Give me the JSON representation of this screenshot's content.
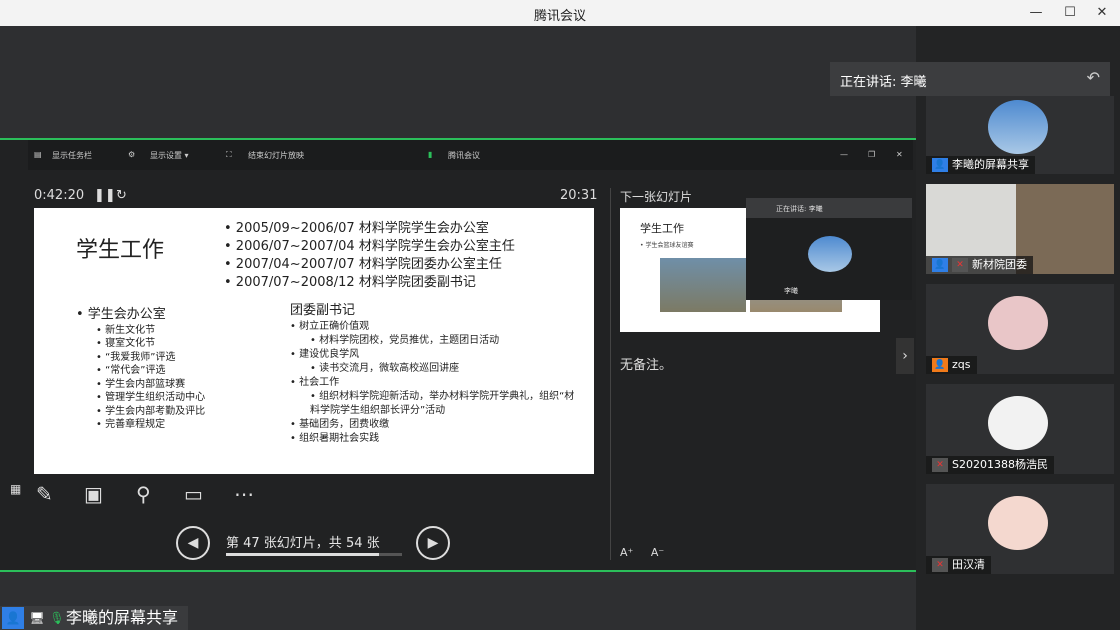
{
  "window": {
    "title": "腾讯会议",
    "min_icon": "minimize-icon",
    "max_icon": "maximize-icon",
    "close_icon": "close-icon"
  },
  "speaking_banner": {
    "label": "正在讲话: 李曦"
  },
  "shared_window": {
    "topbar": {
      "show_taskbar": "显示任务栏",
      "display_settings": "显示设置 ▾",
      "end_slideshow": "结束幻灯片放映",
      "app_tag": "腾讯会议"
    },
    "elapsed": "0:42:20",
    "clock": "20:31",
    "slide": {
      "title": "学生工作",
      "dates": [
        "• 2005/09~2006/07 材料学院学生会办公室",
        "• 2006/07~2007/04 材料学院学生会办公室主任",
        "• 2007/04~2007/07 材料学院团委办公室主任",
        "• 2007/07~2008/12 材料学院团委副书记"
      ],
      "left_heading": "• 学生会办公室",
      "left_items": [
        "• 新生文化节",
        "• 寝室文化节",
        "• “我爱我师”评选",
        "• “常代会”评选",
        "• 学生会内部篮球赛",
        "• 管理学生组织活动中心",
        "• 学生会内部考勤及评比",
        "• 完善章程规定"
      ],
      "right_heading": "团委副书记",
      "right_items": [
        "• 树立正确价值观",
        "    • 材料学院团校，党员推优，主题团日活动",
        "• 建设优良学风",
        "    • 读书交流月，微软高校巡回讲座",
        "• 社会工作",
        "    • 组织材料学院迎新活动，举办材料学院开学典礼，组织“材料学院学生组织部长评分”活动",
        "• 基础团务，团费收缴",
        "• 组织暑期社会实践"
      ]
    },
    "nav": {
      "prev": "◀",
      "next": "▶",
      "status": "第 47 张幻灯片，共 54 张",
      "progress": 0.87
    },
    "next_label": "下一张幻灯片",
    "next_thumb_title": "学生工作",
    "next_thumb_bullet": "• 学生会篮球友谊赛",
    "notes": "无备注。",
    "mini_speaker": {
      "label": "正在讲话: 李曦",
      "name": "李曦"
    }
  },
  "bottom_label": "李曦的屏幕共享",
  "participants": [
    {
      "name": "李曦的屏幕共享",
      "icon": "screen-share-icon"
    },
    {
      "name": "新材院团委",
      "icon": "mic-muted-icon"
    },
    {
      "name": "zqs",
      "icon": "user-icon"
    },
    {
      "name": "S20201388杨浩民",
      "icon": "mic-muted-icon"
    },
    {
      "name": "田汉清",
      "icon": "mic-muted-icon"
    }
  ]
}
